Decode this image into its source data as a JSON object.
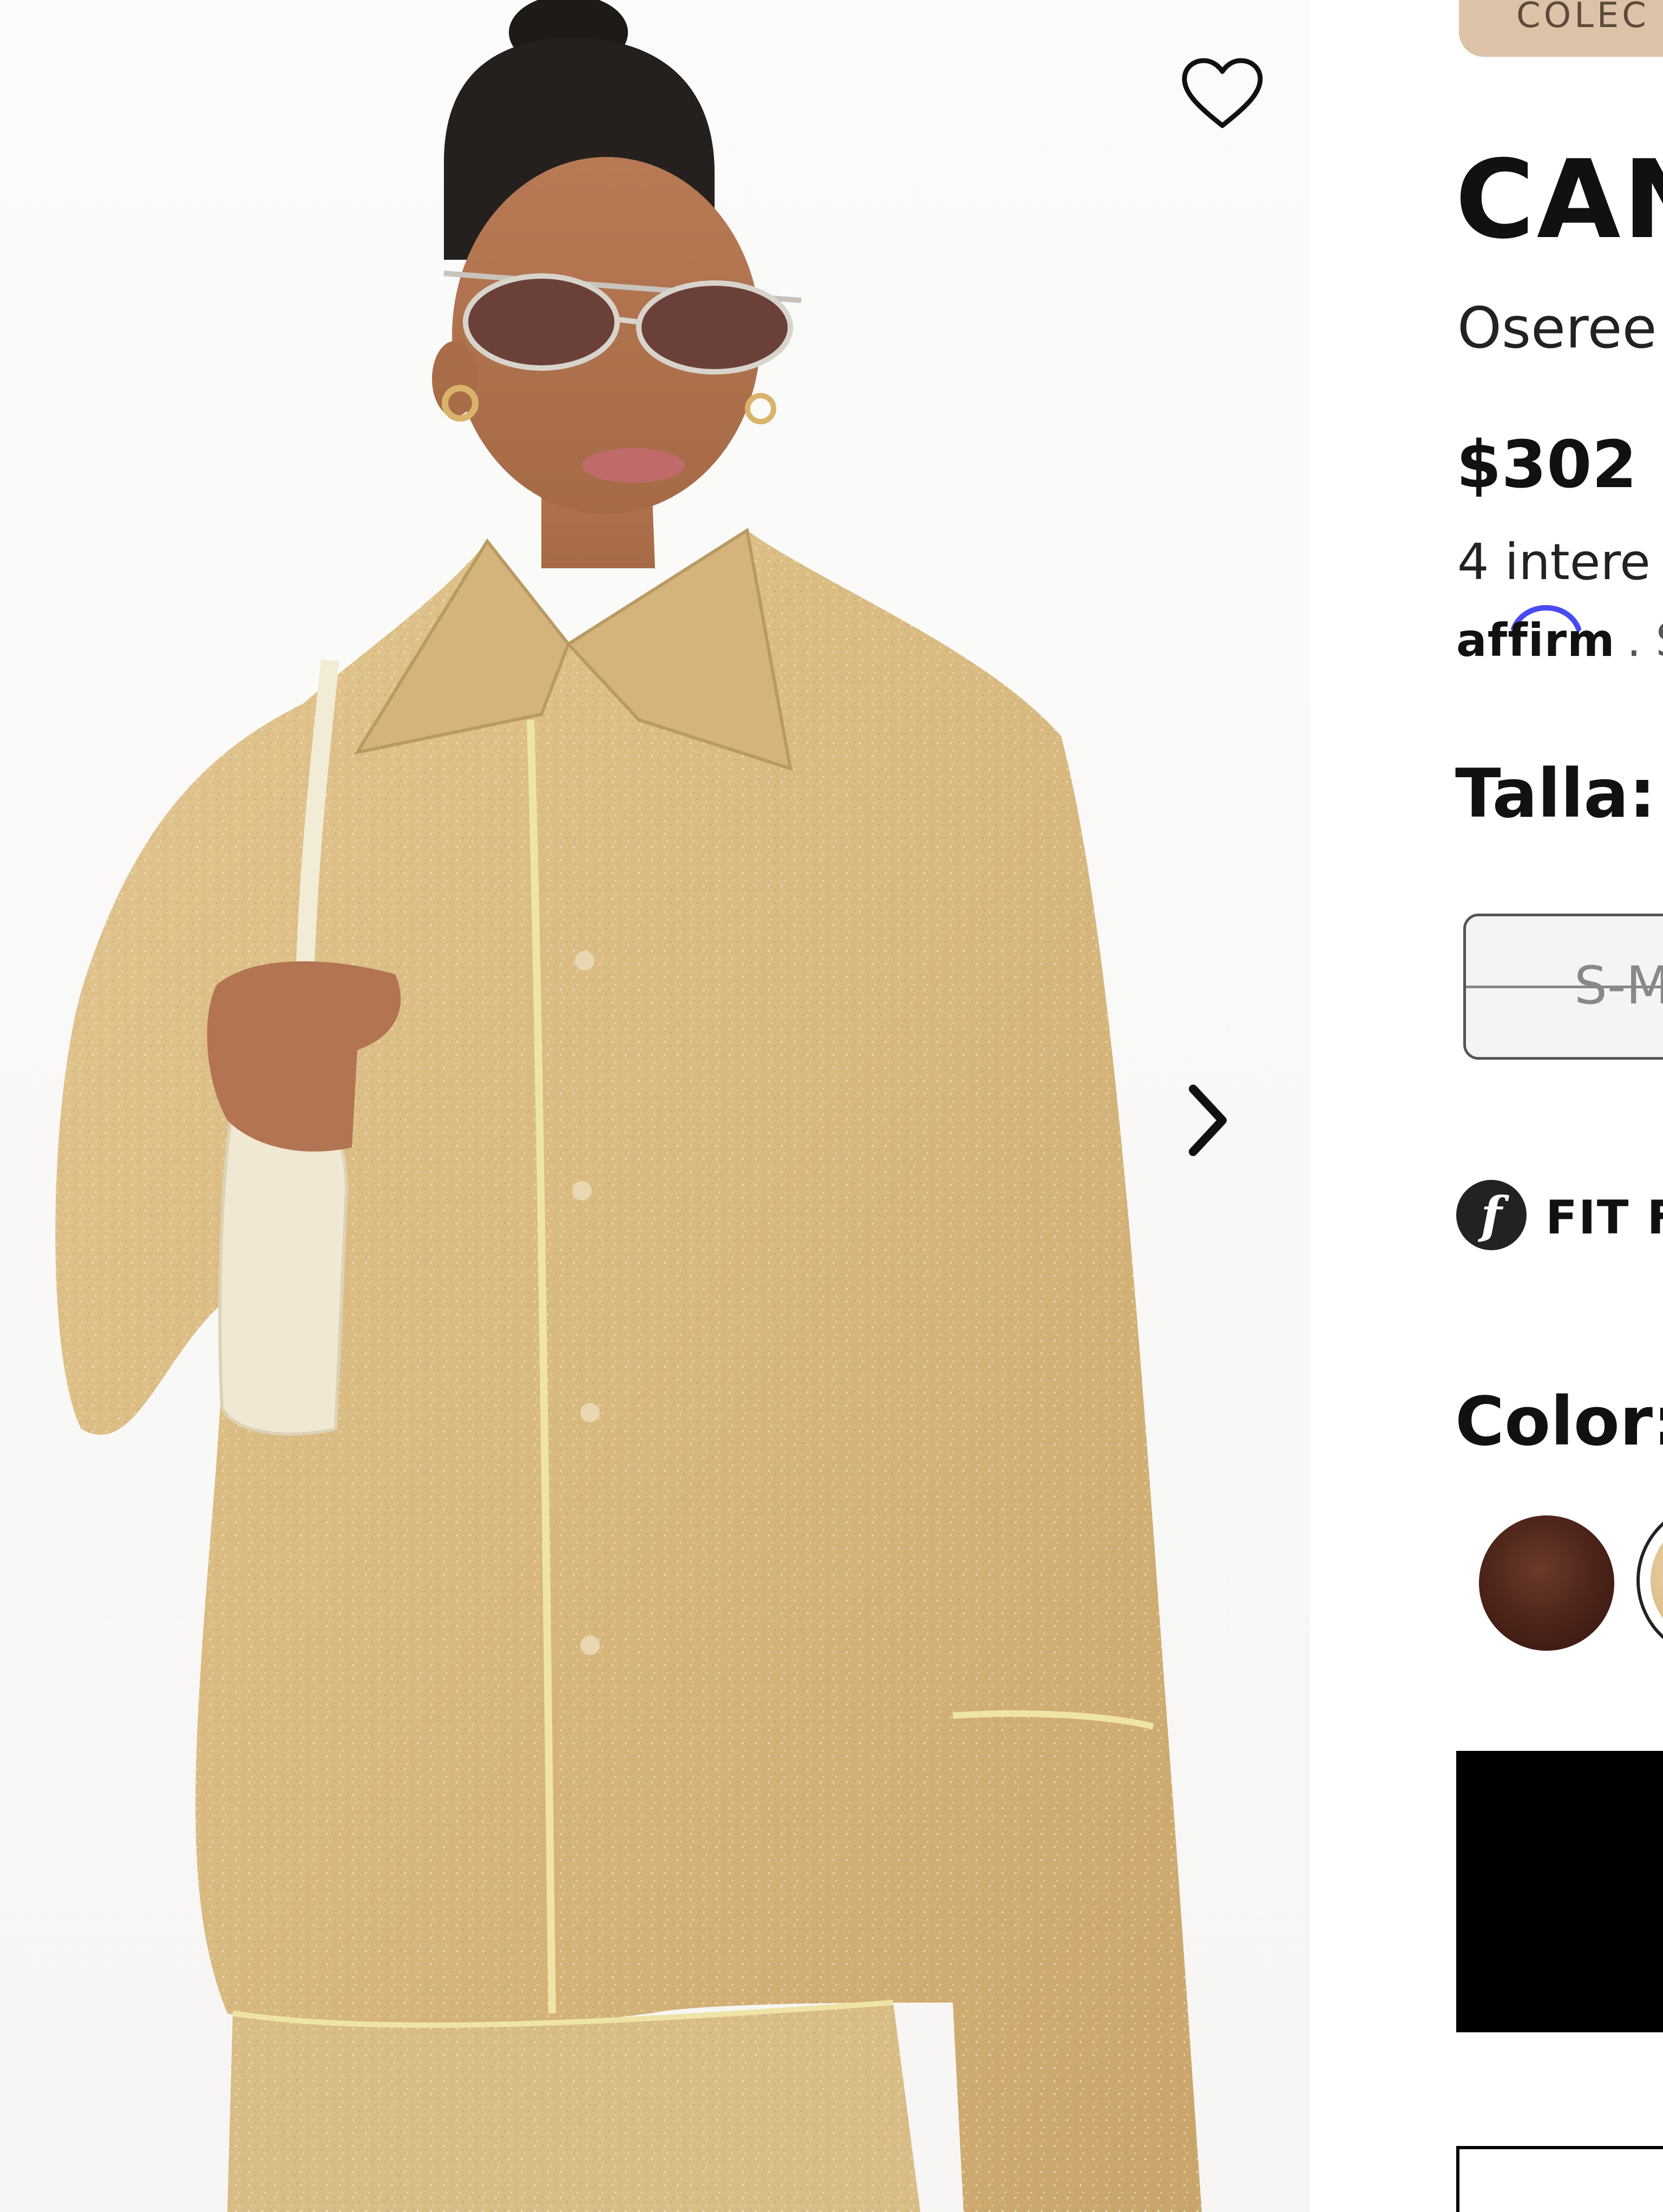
{
  "product": {
    "collection_badge": "COLEC",
    "title": "CAN",
    "brand": "Oseree",
    "price": "$302",
    "installments_text": "4 intere",
    "affirm_logo": "affirm",
    "affirm_more": ". S"
  },
  "size": {
    "label": "Talla:",
    "options": [
      {
        "label": "S-M",
        "available": false
      }
    ]
  },
  "fit": {
    "icon_letter": "f",
    "label": "FIT F"
  },
  "color": {
    "label": "Color:",
    "swatches": [
      {
        "name": "brown",
        "hex": "#4a2218",
        "selected": false
      },
      {
        "name": "gold",
        "hex": "#dcbd8a",
        "selected": true
      }
    ]
  },
  "icons": {
    "wishlist": "heart-outline-icon",
    "next": "chevron-right-icon"
  },
  "colors": {
    "badge_bg": "#dcc3a8",
    "primary_button": "#000000",
    "swatch_brown": "#4a2218",
    "swatch_gold": "#dcbd8a"
  }
}
